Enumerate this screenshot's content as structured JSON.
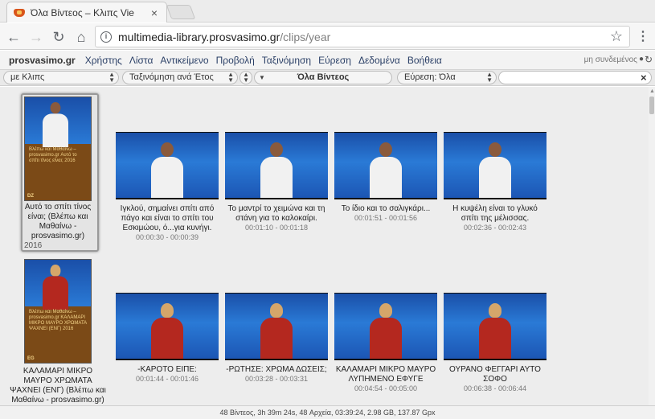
{
  "browser": {
    "tab_title": "Όλα Βίντεος – Κλιπς Vie",
    "url_host": "multimedia-library.prosvasimo.gr",
    "url_path": "/clips/year"
  },
  "menubar": {
    "brand": "prosvasimo.gr",
    "items": [
      "Χρήστης",
      "Λίστα",
      "Αντικείμενο",
      "Προβολή",
      "Ταξινόμηση",
      "Εύρεση",
      "Δεδομένα",
      "Βοήθεια"
    ],
    "user_status": "μη συνδεμένος"
  },
  "filterbar": {
    "view_select": "με Κλιπς",
    "sort_select": "Ταξινόμηση ανά Έτος",
    "title": "Όλα Βίντεος",
    "find_select": "Εύρεση: Όλα",
    "search_value": ""
  },
  "posters": [
    {
      "poster_text": "Βλέπω και Μαθαίνω – prosvasimo.gr\nΑυτό το σπίτι τίνος είναι;\n2016",
      "code": "DZ",
      "caption": "Αυτό το σπίτι τίνος είναι; (Βλέπω και Μαθαίνω - prosvasimo.gr)",
      "year": "2016"
    },
    {
      "poster_text": "Βλέπω και Μαθαίνω – prosvasimo.gr\nΚΑΛΑΜΑΡΙ ΜΙΚΡΟ ΜΑΥΡΟ ΧΡΩΜΑΤΑ ΨΑΧΝΕΙ (ΕΝΓ)\n2016",
      "code": "EG",
      "caption": "ΚΑΛΑΜΑΡΙ ΜΙΚΡΟ ΜΑΥΡΟ ΧΡΩΜΑΤΑ ΨΑΧΝΕΙ (ΕΝΓ) (Βλέπω και Μαθαίνω - prosvasimo.gr)",
      "year": "2016"
    }
  ],
  "row1": [
    {
      "caption": "Ιγκλού, σημαίνει σπίτι από πάγο και είναι το σπίτι του Εσκιμώου, ό...για κυνήγι.",
      "time": "00:00:30 - 00:00:39"
    },
    {
      "caption": "Το μαντρί το χειμώνα και τη στάνη για το καλοκαίρι.",
      "time": "00:01:10 - 00:01:18"
    },
    {
      "caption": "Το ίδιο και το σαλιγκάρι...",
      "time": "00:01:51 - 00:01:56"
    },
    {
      "caption": "Η κυψέλη είναι το γλυκό σπίτι της μέλισσας.",
      "time": "00:02:36 - 00:02:43"
    }
  ],
  "row2": [
    {
      "caption": "-ΚΑΡΟΤΟ ΕΙΠΕ:",
      "time": "00:01:44 - 00:01:46"
    },
    {
      "caption": "-ΡΩΤΗΣΕ: ΧΡΩΜΑ ΔΩΣΕΙΣ;",
      "time": "00:03:28 - 00:03:31"
    },
    {
      "caption": "ΚΑΛΑΜΑΡΙ ΜΙΚΡΟ ΜΑΥΡΟ ΛΥΠΗΜΕΝΟ ΕΦΥΓΕ",
      "time": "00:04:54 - 00:05:00"
    },
    {
      "caption": "ΟΥΡΑΝΟ ΦΕΓΓΑΡΙ ΑΥΤΟ ΣΟΦΟ",
      "time": "00:06:38 - 00:06:44"
    }
  ],
  "status": "48 Βίντεος, 3h 39m 24s, 48 Αρχεία, 03:39:24, 2.98 GB, 137.87 Gpx",
  "colors": {
    "accent": "#2a3f66",
    "video_blue": "#2a7ad6",
    "poster_brown": "#7b4a17"
  }
}
